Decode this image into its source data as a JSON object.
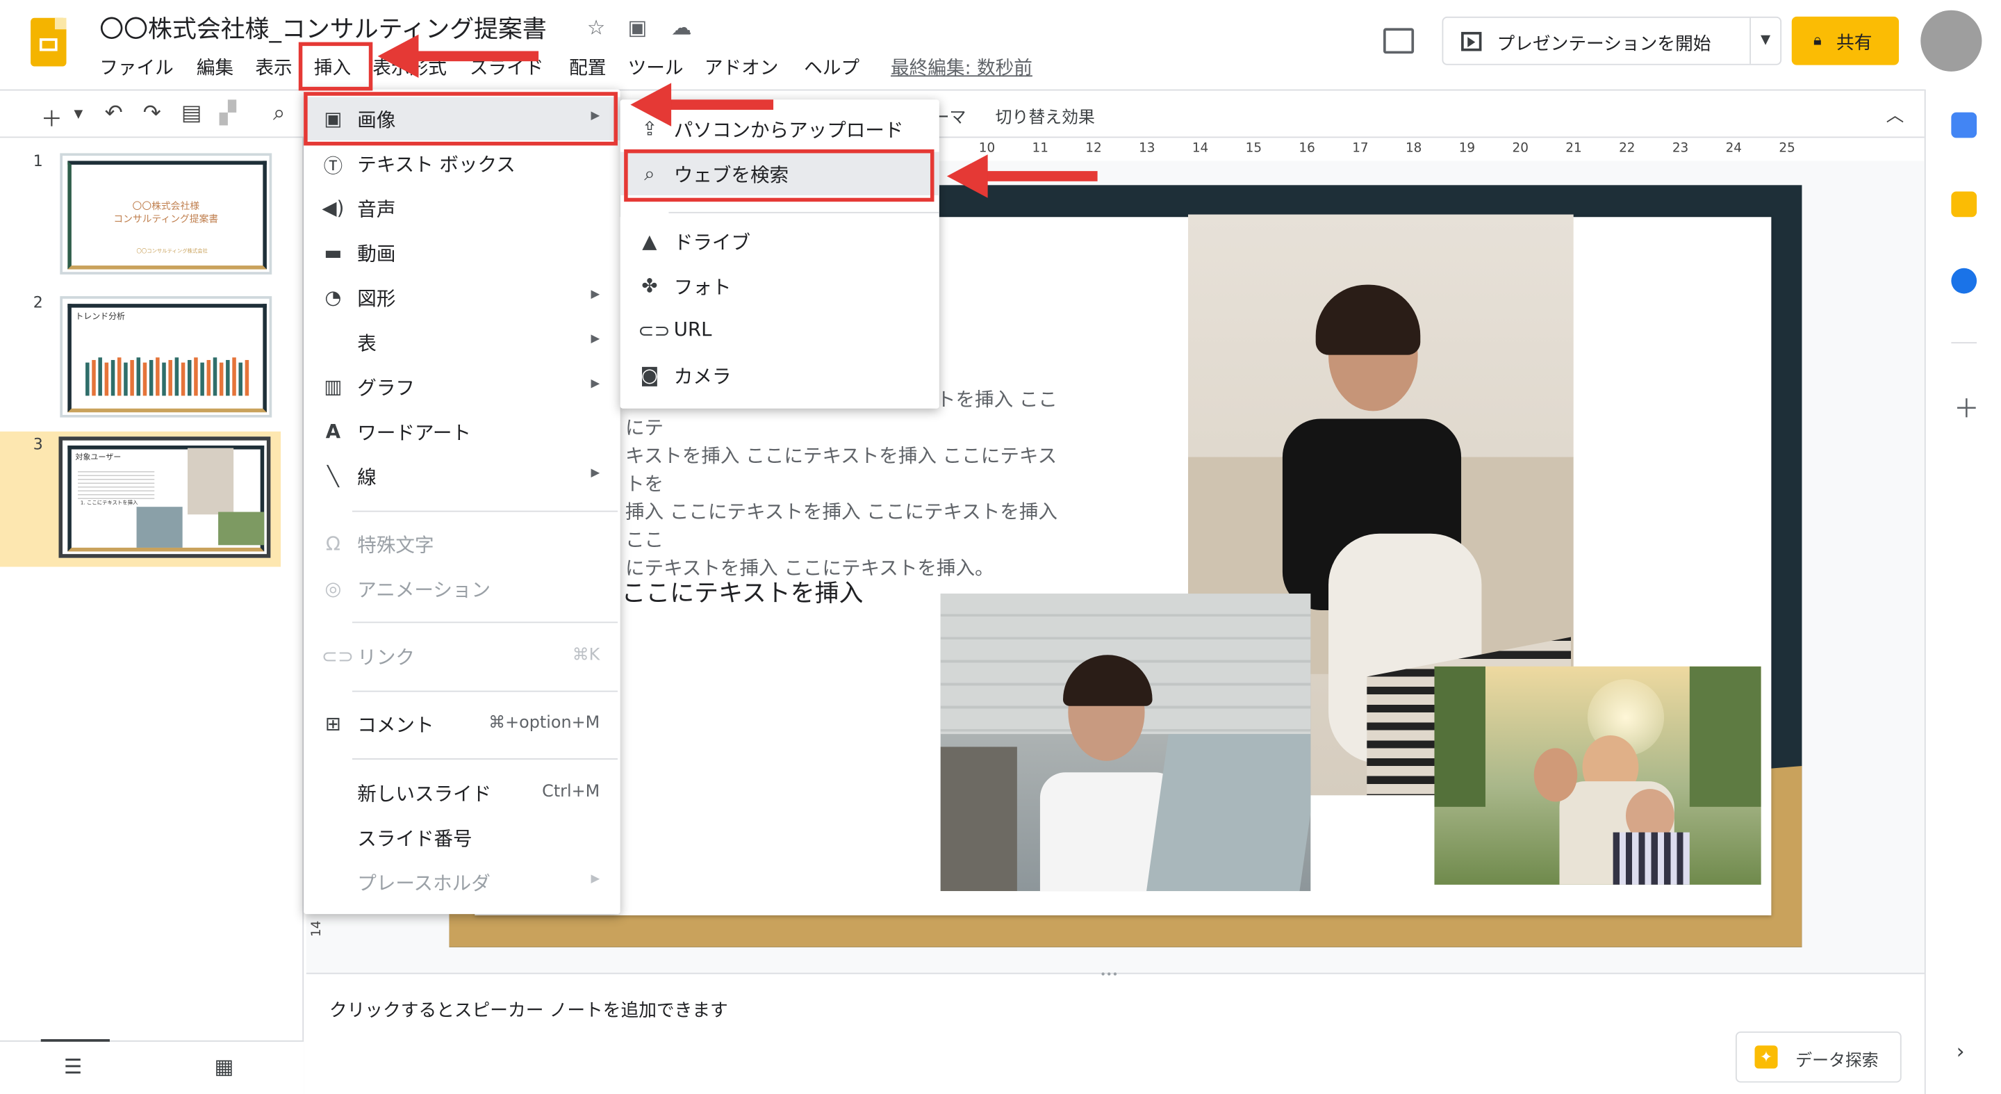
{
  "doc": {
    "title": "〇〇株式会社様_コンサルティング提案書"
  },
  "menubar": {
    "items": [
      "ファイル",
      "編集",
      "表示",
      "挿入",
      "表示形式",
      "スライド",
      "配置",
      "ツール",
      "アドオン",
      "ヘルプ"
    ],
    "last_edit": "最終編集: 数秒前"
  },
  "header": {
    "present_label": "プレゼンテーションを開始",
    "share_label": "共有"
  },
  "toolbar": {
    "theme_label": "テーマ",
    "transition_label": "切り替え効果"
  },
  "ruler": {
    "ticks": [
      "10",
      "11",
      "12",
      "13",
      "14",
      "15",
      "16",
      "17",
      "18",
      "19",
      "20",
      "21",
      "22",
      "23",
      "24",
      "25"
    ],
    "vertical_mark": "14"
  },
  "filmstrip": {
    "slides": [
      {
        "number": "1",
        "title_line1": "〇〇株式会社様",
        "title_line2": "コンサルティング提案書",
        "footer": "〇〇コンサルティング株式会社"
      },
      {
        "number": "2",
        "title": "トレンド分析"
      },
      {
        "number": "3",
        "title": "対象ユーザー",
        "bullet": "1.  ここにテキストを挿入"
      }
    ]
  },
  "insert_menu": {
    "items": [
      {
        "label": "画像",
        "has_submenu": true,
        "icon": "image-icon"
      },
      {
        "label": "テキスト ボックス",
        "icon": "text-box-icon"
      },
      {
        "label": "音声",
        "icon": "audio-icon"
      },
      {
        "label": "動画",
        "icon": "video-icon"
      },
      {
        "label": "図形",
        "has_submenu": true,
        "icon": "shape-icon"
      },
      {
        "label": "表",
        "has_submenu": true
      },
      {
        "label": "グラフ",
        "has_submenu": true,
        "icon": "chart-icon"
      },
      {
        "label": "ワードアート",
        "icon": "word-art-icon"
      },
      {
        "label": "線",
        "has_submenu": true,
        "icon": "line-icon"
      },
      {
        "label": "特殊文字",
        "disabled": true,
        "icon": "omega-icon"
      },
      {
        "label": "アニメーション",
        "disabled": true,
        "icon": "animation-icon"
      },
      {
        "label": "リンク",
        "shortcut": "⌘K",
        "disabled": true,
        "icon": "link-icon"
      },
      {
        "label": "コメント",
        "shortcut": "⌘+option+M",
        "icon": "comment-icon"
      },
      {
        "label": "新しいスライド",
        "shortcut": "Ctrl+M"
      },
      {
        "label": "スライド番号"
      },
      {
        "label": "プレースホルダ",
        "has_submenu": true,
        "disabled": true
      }
    ]
  },
  "image_submenu": {
    "items": [
      {
        "label": "パソコンからアップロード",
        "icon": "upload-icon"
      },
      {
        "label": "ウェブを検索",
        "icon": "search-icon"
      },
      {
        "label": "ドライブ",
        "icon": "drive-icon"
      },
      {
        "label": "フォト",
        "icon": "photos-icon"
      },
      {
        "label": "URL",
        "icon": "link-icon"
      },
      {
        "label": "カメラ",
        "icon": "camera-icon"
      }
    ]
  },
  "slide": {
    "body_lines": [
      "ここにテキストを挿入 ここにテキストを挿入 ここにテ",
      "キストを挿入 ここにテキストを挿入 ここにテキストを",
      "挿入 ここにテキストを挿入 ここにテキストを挿入 ここ",
      "にテキストを挿入 ここにテキストを挿入。"
    ],
    "subheading": "ここにテキストを挿入"
  },
  "notes": {
    "placeholder": "クリックするとスピーカー ノートを追加できます"
  },
  "explore": {
    "label": "データ探索"
  },
  "colors": {
    "accent_yellow": "#fbbc04",
    "highlight_red": "#e53935",
    "slide_dark": "#1e2f38",
    "slide_gold": "#c9a25c"
  }
}
